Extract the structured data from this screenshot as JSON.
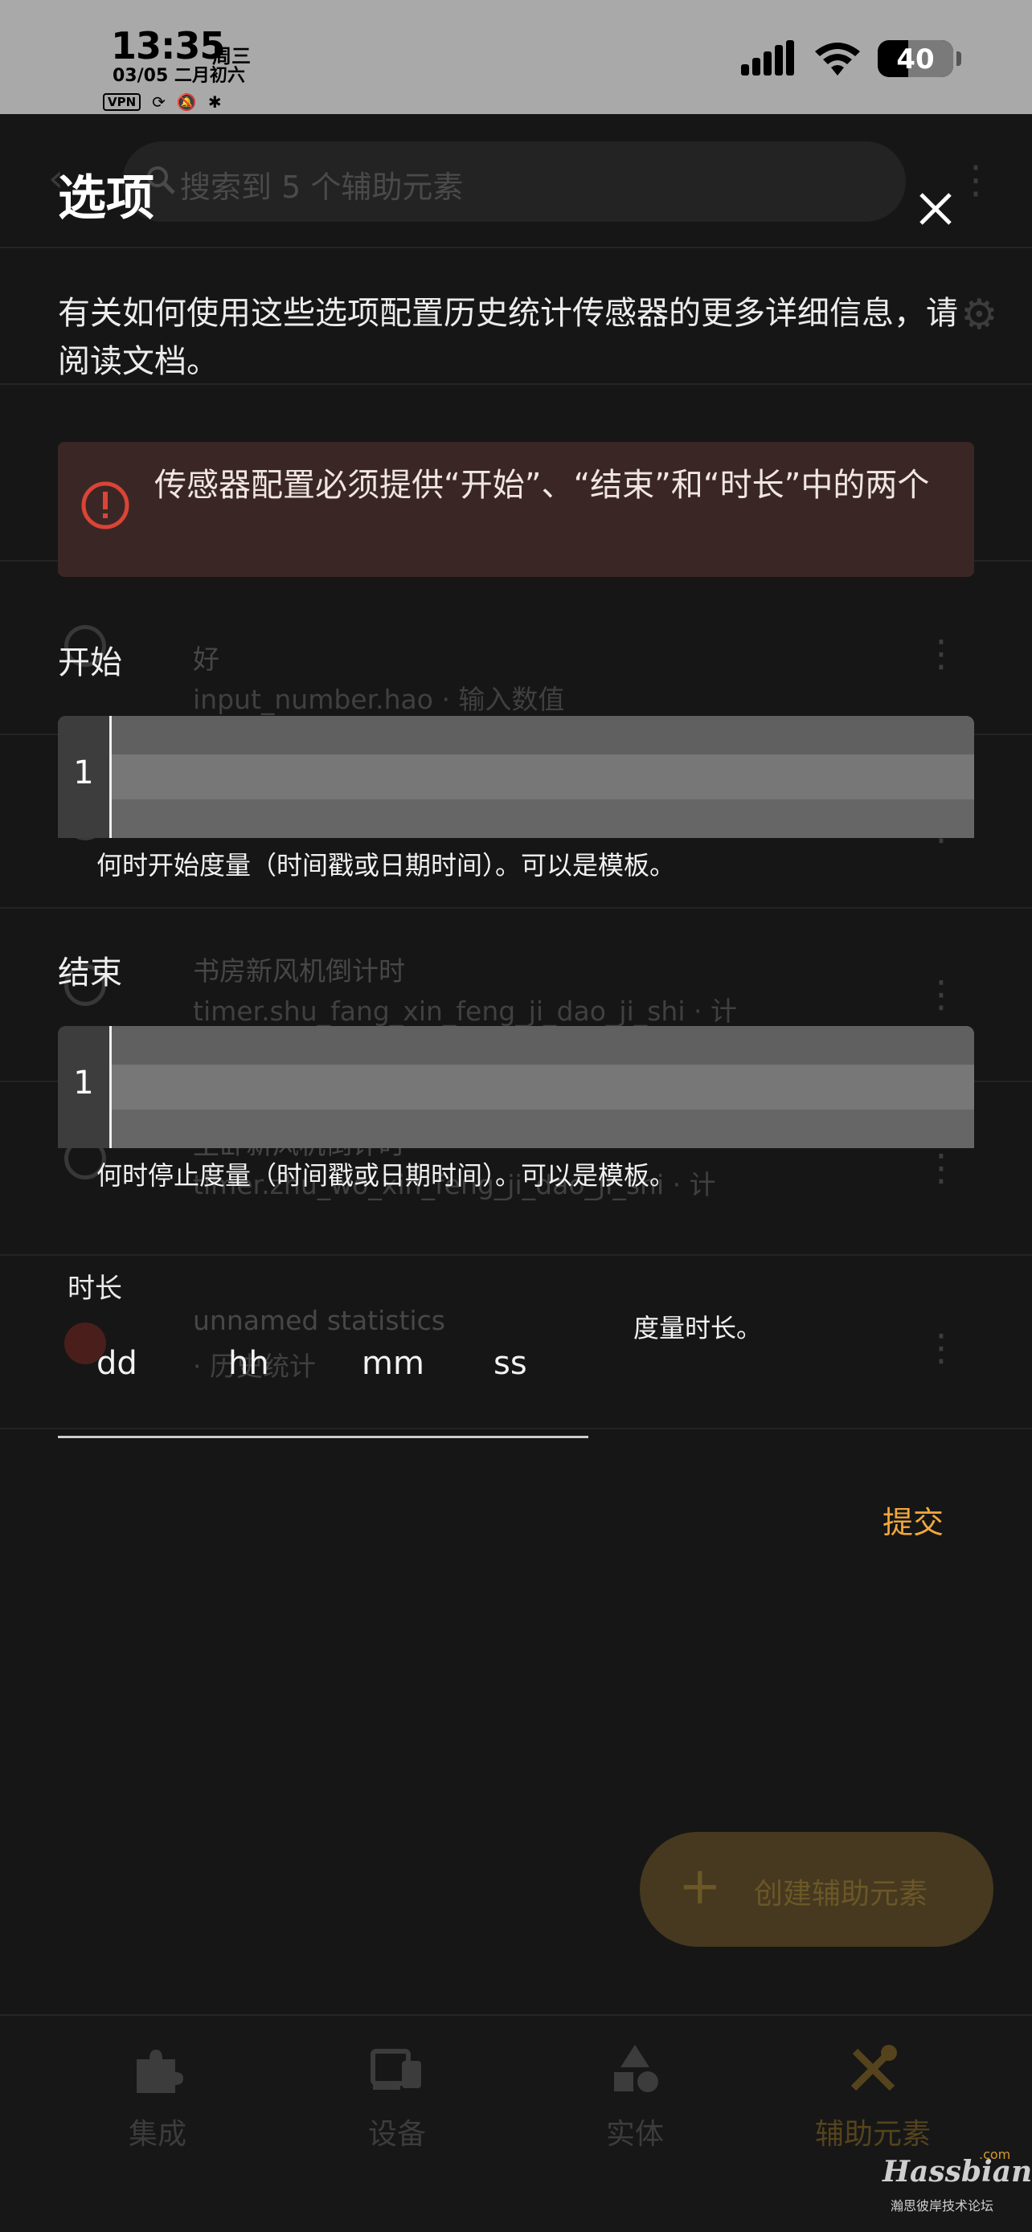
{
  "status_bar": {
    "time": "13:35",
    "weekday": "周三",
    "date": "03/05 二月初六",
    "vpn": "VPN",
    "battery": "40"
  },
  "background": {
    "search_placeholder": "搜索到 5 个辅助元素",
    "rows": [
      {
        "title": "好",
        "subtitle": "input_number.hao · 输入数值"
      },
      {
        "title": "书房新风机倒计时",
        "subtitle": "timer.shu_fang_xin_feng_ji_dao_ji_shi · 计"
      },
      {
        "title": "主卧新风机倒计时",
        "subtitle": "timer.zhu_wo_xin_feng_ji_dao_ji_shi · 计"
      },
      {
        "title": "unnamed statistics",
        "subtitle": "· 历史统计"
      }
    ],
    "fab_label": "创建辅助元素",
    "nav": [
      {
        "label": "集成",
        "icon": "puzzle-icon"
      },
      {
        "label": "设备",
        "icon": "devices-icon"
      },
      {
        "label": "实体",
        "icon": "shapes-icon"
      },
      {
        "label": "辅助元素",
        "icon": "tools-icon",
        "active": true
      }
    ],
    "watermark": "Hassbian",
    "watermark_com": ".com",
    "watermark_sub": "瀚思彼岸技术论坛"
  },
  "dialog": {
    "title": "选项",
    "description": "有关如何使用这些选项配置历史统计传感器的更多详细信息，请阅读文档。",
    "alert": "传感器配置必须提供“开始”、“结束”和“时长”中的两个",
    "start": {
      "label": "开始",
      "line_number": "1",
      "helper": "何时开始度量（时间戳或日期时间）。可以是模板。"
    },
    "end": {
      "label": "结束",
      "line_number": "1",
      "helper": "何时停止度量（时间戳或日期时间）。可以是模板。"
    },
    "duration": {
      "label": "时长",
      "units": [
        "dd",
        "hh",
        "mm",
        "ss"
      ],
      "helper": "度量时长。"
    },
    "submit": "提交"
  },
  "colors": {
    "accent": "#f3a83b",
    "error": "#db4437",
    "alert_bg": "#3a2725",
    "dialog_bg": "#1c1c1c"
  }
}
